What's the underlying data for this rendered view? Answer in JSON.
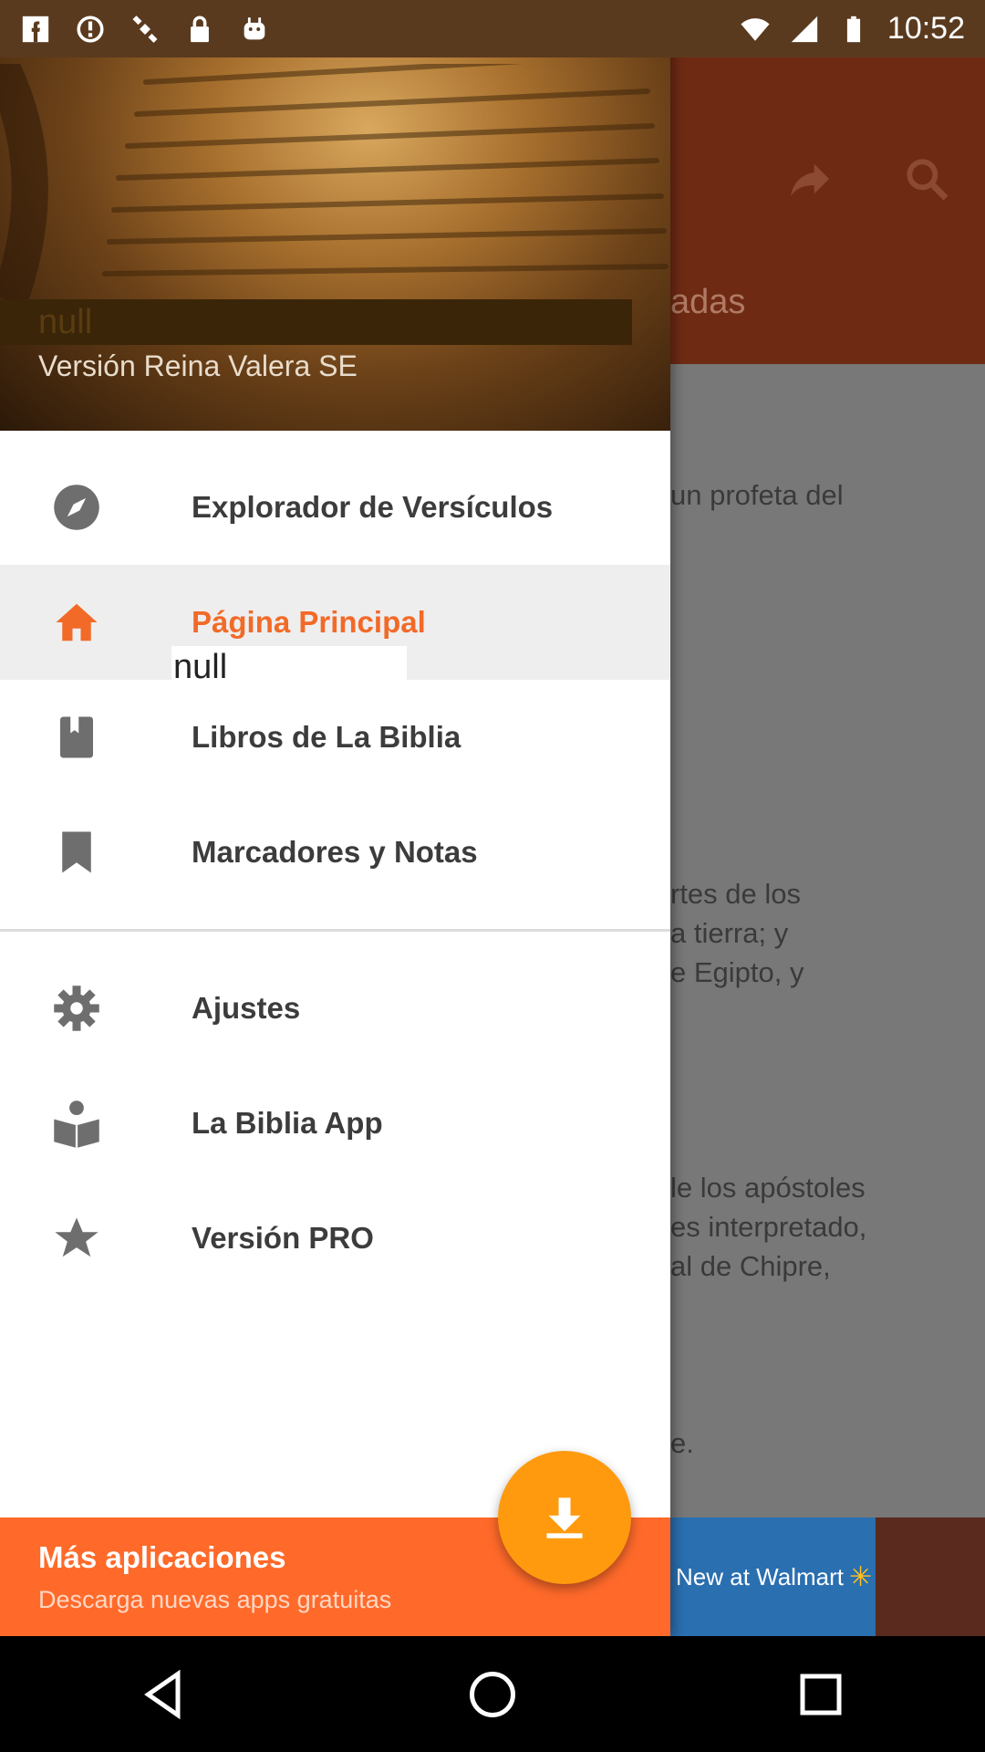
{
  "status_bar": {
    "time": "10:52",
    "left_icons": [
      "facebook-icon",
      "blocked-icon",
      "satellite-icon",
      "lock-icon",
      "android-icon"
    ],
    "right_icons": [
      "wifi-icon",
      "signal-icon",
      "battery-icon"
    ]
  },
  "background_app": {
    "toolbar_color": "#6f2a14",
    "tab_fragment": "adas",
    "text_fragments": [
      [
        "un profeta del"
      ],
      [
        "rtes de los",
        "a tierra; y",
        "e Egipto, y"
      ],
      [
        "le los apóstoles",
        "es interpretado,",
        "al de Chipre,"
      ],
      [
        "e."
      ]
    ],
    "ad_text": "New at Walmart"
  },
  "drawer": {
    "header": {
      "title": "null",
      "subtitle": "Versión Reina Valera SE"
    },
    "items": [
      {
        "label": "Explorador de Versículos",
        "icon": "compass-icon",
        "active": false
      },
      {
        "label": "Página Principal",
        "icon": "home-icon",
        "active": true
      },
      {
        "label": "Libros de La Biblia",
        "icon": "book-icon",
        "active": false
      },
      {
        "label": "Marcadores y Notas",
        "icon": "bookmark-icon",
        "active": false
      },
      {
        "label": "Ajustes",
        "icon": "gear-icon",
        "active": false
      },
      {
        "label": "La Biblia App",
        "icon": "reader-icon",
        "active": false
      },
      {
        "label": "Versión PRO",
        "icon": "star-icon",
        "active": false
      }
    ],
    "overlay_null": "null",
    "footer": {
      "title": "Más aplicaciones",
      "subtitle": "Descarga nuevas apps gratuitas"
    }
  },
  "colors": {
    "accent": "#f26a28",
    "footer": "#ff6a2a",
    "fab": "#ff9a0e",
    "icon": "#6e6e6e"
  }
}
